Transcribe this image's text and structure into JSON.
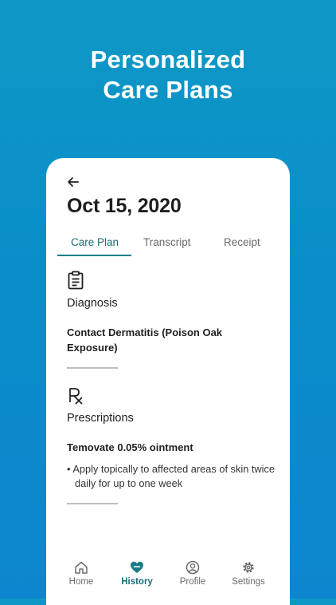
{
  "headline": {
    "line1": "Personalized",
    "line2": "Care Plans"
  },
  "screen": {
    "date": "Oct 15, 2020",
    "tabs": [
      {
        "label": "Care Plan",
        "active": true
      },
      {
        "label": "Transcript",
        "active": false
      },
      {
        "label": "Receipt",
        "active": false
      }
    ],
    "diagnosis": {
      "icon": "clipboard-icon",
      "title": "Diagnosis",
      "value": "Contact Dermatitis (Poison Oak Exposure)"
    },
    "prescriptions": {
      "icon": "rx-icon",
      "title": "Prescriptions",
      "medication": "Temovate 0.05% ointment",
      "instruction": "• Apply topically to affected areas of skin twice daily for up to one week"
    }
  },
  "navbar": {
    "items": [
      {
        "label": "Home",
        "icon": "home-icon",
        "active": false
      },
      {
        "label": "History",
        "icon": "heart-icon",
        "active": true
      },
      {
        "label": "Profile",
        "icon": "profile-icon",
        "active": false
      },
      {
        "label": "Settings",
        "icon": "gear-icon",
        "active": false
      }
    ]
  },
  "colors": {
    "background": "#0a8fc9",
    "accent": "#1a7d8a",
    "text": "#1e1e1e"
  }
}
